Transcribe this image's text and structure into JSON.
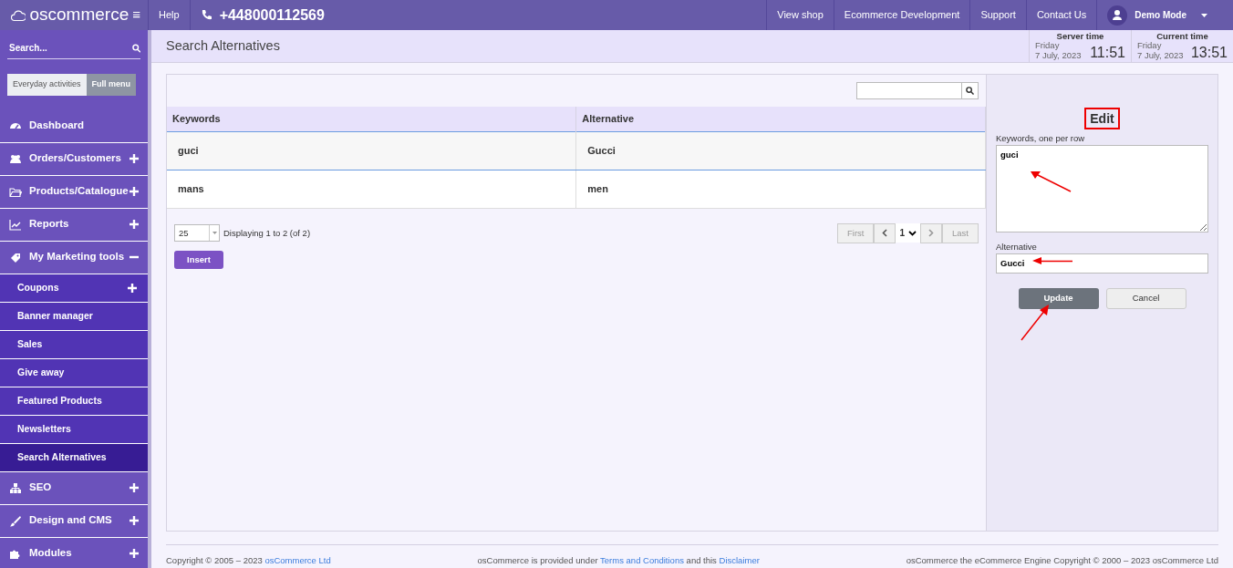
{
  "topbar": {
    "logo": "oscommerce",
    "menu_toggle": "≡",
    "help": "Help",
    "phone": "+448000112569",
    "links": [
      "View shop",
      "Ecommerce Development",
      "Support",
      "Contact Us"
    ],
    "user": "Demo Mode"
  },
  "sidebar": {
    "search_placeholder": "Search...",
    "modes": [
      {
        "label": "Everyday activities",
        "selected": false
      },
      {
        "label": "Full menu",
        "selected": true
      }
    ],
    "items": [
      {
        "label": "Dashboard",
        "expandable": false,
        "expanded": false,
        "selected": false
      },
      {
        "label": "Orders/Customers",
        "expandable": true,
        "expanded": false,
        "selected": false
      },
      {
        "label": "Products/Catalogue",
        "expandable": true,
        "expanded": false,
        "selected": false
      },
      {
        "label": "Reports",
        "expandable": true,
        "expanded": false,
        "selected": false
      },
      {
        "label": "My Marketing tools",
        "expandable": true,
        "expanded": true,
        "selected": false,
        "children": [
          {
            "label": "Coupons",
            "expandable": true,
            "expanded": false,
            "selected": false
          },
          {
            "label": "Banner manager",
            "expandable": false,
            "expanded": false,
            "selected": false
          },
          {
            "label": "Sales",
            "expandable": false,
            "expanded": false,
            "selected": false
          },
          {
            "label": "Give away",
            "expandable": false,
            "expanded": false,
            "selected": false
          },
          {
            "label": "Featured Products",
            "expandable": false,
            "expanded": false,
            "selected": false
          },
          {
            "label": "Newsletters",
            "expandable": false,
            "expanded": false,
            "selected": false
          },
          {
            "label": "Search Alternatives",
            "expandable": false,
            "expanded": false,
            "selected": true
          }
        ]
      },
      {
        "label": "SEO",
        "expandable": true,
        "expanded": false,
        "selected": false
      },
      {
        "label": "Design and CMS",
        "expandable": true,
        "expanded": false,
        "selected": false
      },
      {
        "label": "Modules",
        "expandable": true,
        "expanded": false,
        "selected": false
      }
    ]
  },
  "page_title": "Search Alternatives",
  "clocks": [
    {
      "label": "Server time",
      "day": "Friday",
      "date": "7 July, 2023",
      "time": "11:51"
    },
    {
      "label": "Current time",
      "day": "Friday",
      "date": "7 July, 2023",
      "time": "13:51"
    }
  ],
  "table": {
    "columns": [
      "Keywords",
      "Alternative"
    ],
    "rows": [
      {
        "cells": [
          "guci",
          "Gucci"
        ],
        "selected": true
      },
      {
        "cells": [
          "mans",
          "men"
        ],
        "selected": false
      }
    ]
  },
  "per_page": "25",
  "displaying": "Displaying 1 to 2 (of 2)",
  "pagination": {
    "first": "First",
    "page": "1",
    "last": "Last"
  },
  "insert_button": "Insert",
  "edit": {
    "title": "Edit",
    "highlighted": true,
    "keywords_label": "Keywords, one per row",
    "keywords_value": "guci",
    "alternative_label": "Alternative",
    "alternative_value": "Gucci",
    "buttons": [
      "Update",
      "Cancel"
    ]
  },
  "footer": [
    [
      {
        "kind": "text",
        "text": "Copyright © 2005 – 2023 "
      },
      {
        "kind": "link",
        "text": "osCommerce Ltd"
      }
    ],
    [
      {
        "kind": "text",
        "text": "osCommerce is provided under "
      },
      {
        "kind": "link",
        "text": "Terms and Conditions"
      },
      {
        "kind": "text",
        "text": " and this "
      },
      {
        "kind": "link",
        "text": "Disclaimer"
      }
    ],
    [
      {
        "kind": "text",
        "text": "osCommerce the eCommerce Engine Copyright © 2000 – 2023 osCommerce Ltd"
      }
    ]
  ]
}
